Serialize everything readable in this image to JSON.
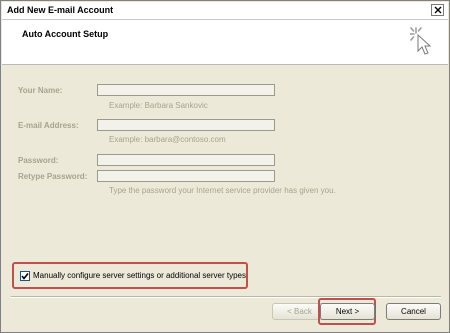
{
  "window": {
    "title": "Add New E-mail Account"
  },
  "header": {
    "section_title": "Auto Account Setup"
  },
  "form": {
    "name_label": "Your Name:",
    "name_value": "",
    "name_hint": "Example: Barbara Sankovic",
    "email_label": "E-mail Address:",
    "email_value": "",
    "email_hint": "Example: barbara@contoso.com",
    "password_label": "Password:",
    "password_value": "",
    "retype_label": "Retype Password:",
    "retype_value": "",
    "password_hint": "Type the password your Internet service provider has given you."
  },
  "manual": {
    "label": "Manually configure server settings or additional server types",
    "checked": true
  },
  "buttons": {
    "back": "< Back",
    "next": "Next >",
    "cancel": "Cancel"
  },
  "colors": {
    "highlight": "#c0504d",
    "dialog_bg": "#ece9d8",
    "disabled_text": "#a6a48e"
  },
  "icons": [
    "close-icon",
    "setup-cursor-icon",
    "checkmark-icon"
  ]
}
